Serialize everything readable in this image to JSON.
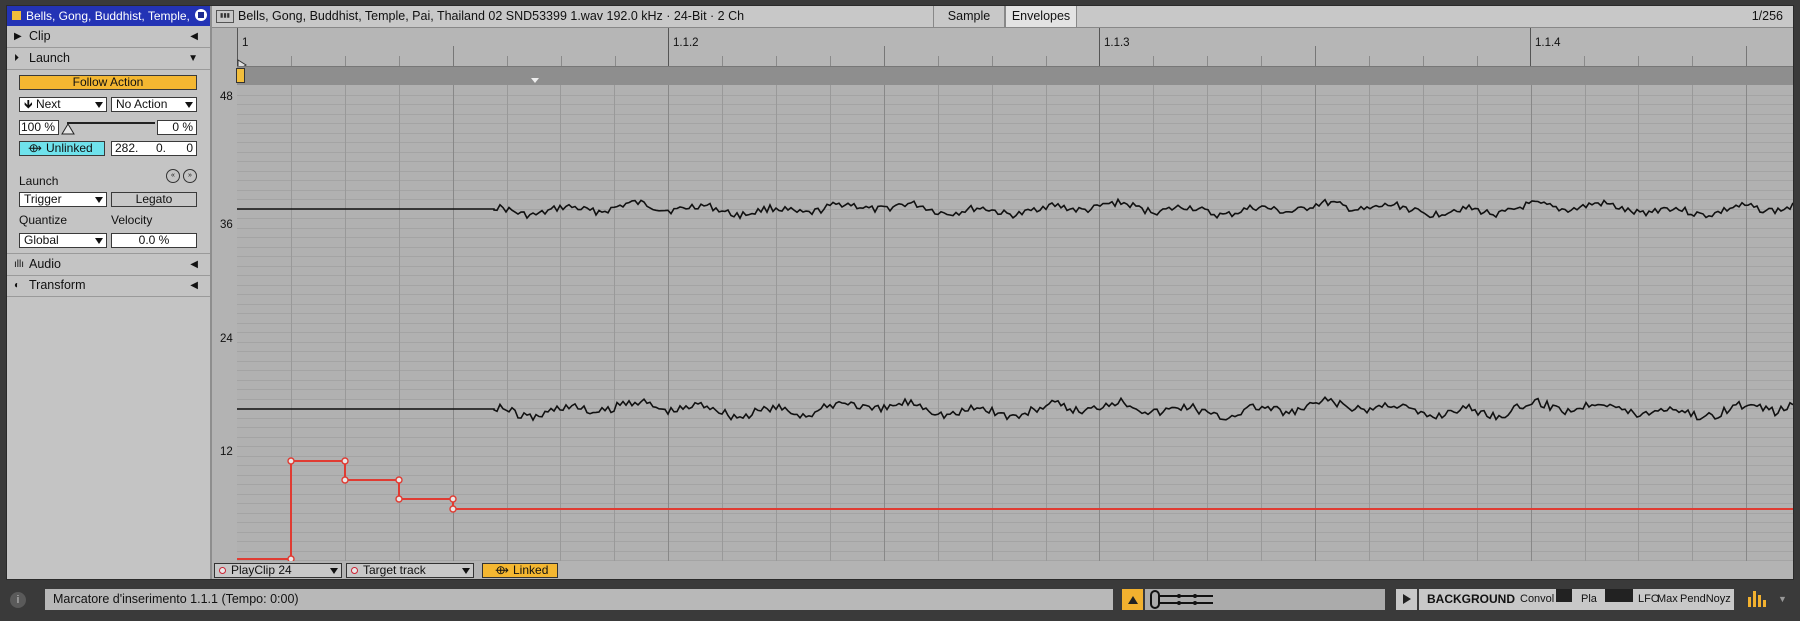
{
  "clip": {
    "title": "Bells, Gong, Buddhist, Temple, Pai, Thailand 02 SND53399 1.wav",
    "color": "#f2be3c"
  },
  "sections": {
    "clip": "Clip",
    "launch": "Launch",
    "audio": "Audio",
    "transform": "Transform"
  },
  "follow_action": {
    "header": "Follow Action",
    "action_a": "Next",
    "action_b": "No Action",
    "chance_a": "100 %",
    "chance_b": "0 %",
    "link_label": "Unlinked",
    "time": [
      "282.",
      "0.",
      "0"
    ]
  },
  "launch": {
    "label": "Launch",
    "mode": "Trigger",
    "legato": "Legato",
    "quantize_label": "Quantize",
    "velocity_label": "Velocity",
    "quantize": "Global",
    "velocity": "0.0 %"
  },
  "topbar": {
    "wave_icon": "waveform-icon",
    "file_info": "Bells, Gong, Buddhist, Temple, Pai, Thailand 02 SND53399 1.wav  192.0 kHz · 24-Bit · 2 Ch",
    "tab_sample": "Sample",
    "tab_envelopes": "Envelopes",
    "zoom": "1/256"
  },
  "ruler": {
    "labels": [
      "1",
      "1.1.2",
      "1.1.3",
      "1.1.4"
    ]
  },
  "yaxis": {
    "labels": [
      "48",
      "36",
      "24",
      "12"
    ]
  },
  "envelope": {
    "device": "PlayClip 24",
    "parameter": "Target track",
    "link": "Linked",
    "color": "#e03b32"
  },
  "status": {
    "message": "Marcatore d'inserimento 1.1.1 (Tempo: 0:00)",
    "background": "BACKGROUND",
    "devices": [
      "Convol",
      "Pla",
      "LFO",
      "Max",
      "PendNoyz"
    ]
  }
}
